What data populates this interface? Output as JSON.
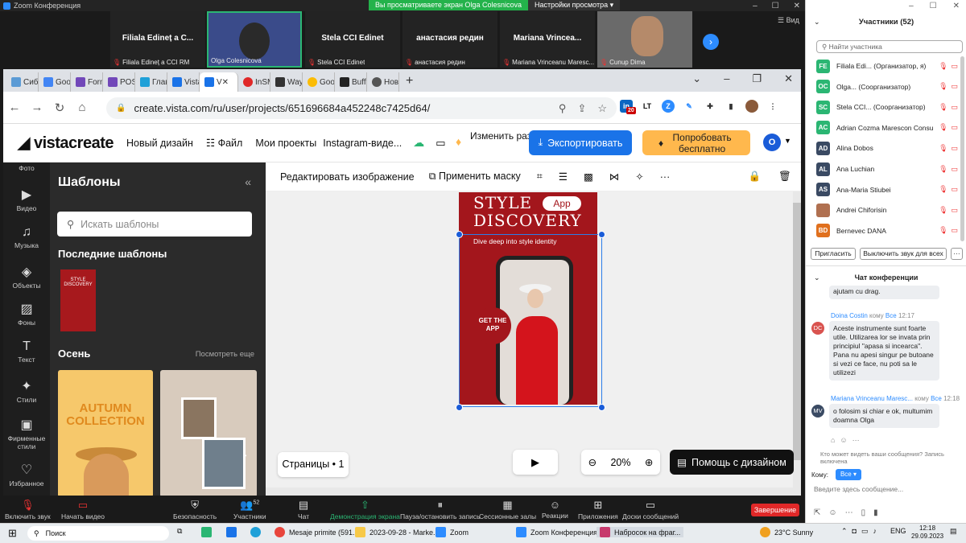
{
  "zoom": {
    "window_title": "Zoom Конференция",
    "share_msg": "Вы просматриваете экран Olga Colesnicova",
    "share_options": "Настройки просмотра",
    "view_label": "Вид",
    "tiles": [
      {
        "name": "Filiala Edineț a C...",
        "sub": "Filiala Edineț a CCI RM"
      },
      {
        "name": "",
        "sub": "Olga Colesnicova"
      },
      {
        "name": "Stela CCI Edinet",
        "sub": "Stela CCI Edinet"
      },
      {
        "name": "анастасия редин",
        "sub": "анастасия редин"
      },
      {
        "name": "Mariana  Vrincea...",
        "sub": "Mariana Vrinceanu Maresc..."
      },
      {
        "name": "",
        "sub": "Cunup Dima"
      }
    ],
    "toolbar": {
      "mute": "Включить звук",
      "video": "Начать видео",
      "security": "Безопасность",
      "participants": "Участники",
      "participants_count": "52",
      "chat": "Чат",
      "share": "Демонстрация экрана",
      "pause": "Пауза/остановить запись",
      "rooms": "Сессионные залы",
      "reactions": "Реакции",
      "apps": "Приложения",
      "whiteboard": "Доски сообщений",
      "end": "Завершение"
    }
  },
  "browser": {
    "tabs": [
      "Сибі",
      "Goo",
      "Forn",
      "POS",
      "Глав",
      "Vista",
      "V",
      "InSM",
      "Way",
      "Goo",
      "Buff",
      "Нов"
    ],
    "url": "create.vista.com/ru/user/projects/651696684a452248c7425d64/",
    "ext_badge": "20"
  },
  "vista": {
    "logo": "vistacreate",
    "menu": [
      "Новый дизайн",
      "Файл",
      "Мои проекты",
      "Instagram-виде..."
    ],
    "resize": "Изменить размер",
    "export": "Экспортировать",
    "try": "Попробовать бесплатно",
    "avatar": "O",
    "rail": [
      "Фото",
      "Видео",
      "Музыка",
      "Объекты",
      "Фоны",
      "Текст",
      "Стили",
      "Фирменные стили",
      "Избранное"
    ],
    "panel_title": "Шаблоны",
    "search_placeholder": "Искать шаблоны",
    "recent_heading": "Последние шаблоны",
    "autumn_heading": "Осень",
    "see_all": "Посмотреть еще",
    "autumn_card": "AUTUMN COLLECTION",
    "edit_image": "Редактировать изображение",
    "apply_mask": "Применить маску",
    "design": {
      "line1": "STYLE",
      "line2": "DISCOVERY",
      "app": "App",
      "subtitle": "Dive deep into style identity",
      "badge": "GET THE APP"
    },
    "pages": "Страницы • 1",
    "zoom_level": "20%",
    "help": "Помощь с дизайном"
  },
  "participants": {
    "title": "Участники (52)",
    "search": "Найти участника",
    "list": [
      {
        "initials": "FE",
        "color": "#2bb673",
        "name": "Filiala Edi... (Организатор, я)"
      },
      {
        "initials": "OC",
        "color": "#2bb673",
        "name": "Olga... (Соорганизатор)"
      },
      {
        "initials": "SC",
        "color": "#2bb673",
        "name": "Stela CCI... (Соорганизатор)"
      },
      {
        "initials": "AC",
        "color": "#2bb673",
        "name": "Adrian Cozma Marescon Consult"
      },
      {
        "initials": "AD",
        "color": "#3a4a63",
        "name": "Alina Dobos"
      },
      {
        "initials": "AL",
        "color": "#3a4a63",
        "name": "Ana Luchian"
      },
      {
        "initials": "AS",
        "color": "#3a4a63",
        "name": "Ana-Maria Stiubei"
      },
      {
        "initials": "",
        "color": "#b07050",
        "name": "Andrei Chiforisin"
      },
      {
        "initials": "BD",
        "color": "#e0701e",
        "name": "Bernevec DANA"
      }
    ],
    "invite": "Пригласить",
    "mute_all": "Выключить звук для всех"
  },
  "chat": {
    "title": "Чат конференции",
    "messages": [
      {
        "author": "",
        "to": "",
        "time": "",
        "text": "ajutam cu drag.",
        "initials": "",
        "color": ""
      },
      {
        "author": "Doina Costin",
        "to": "кому",
        "recipient": "Все",
        "time": "12:17",
        "text": "Aceste instrumente sunt foarte utile. Utilizarea lor se invata prin principiul \"apasa si incearca\". Pana nu apesi singur pe butoane si vezi ce face, nu poti sa le utilizezi",
        "initials": "DC",
        "color": "#d9534f"
      },
      {
        "author": "Mariana Vrinceanu Maresc...",
        "to": "кому",
        "recipient": "Все",
        "time": "12:18",
        "text": "o folosim si chiar e ok, multumim doamna Olga",
        "initials": "MV",
        "color": "#3a4a63"
      }
    ],
    "who_can_see": "Кто может видеть ваши сообщения? Запись включена",
    "to_label": "Кому:",
    "to_value": "Все",
    "input_placeholder": "Введите здесь сообщение..."
  },
  "taskbar": {
    "search": "Поиск",
    "apps": [
      "Mesaje primite (591...",
      "2023-09-28 - Marke...",
      "Zoom",
      "Zoom Конференция",
      "Набросок на фраг..."
    ],
    "weather": "23°C  Sunny",
    "lang": "ENG",
    "time": "12:18",
    "date": "29.09.2023"
  }
}
